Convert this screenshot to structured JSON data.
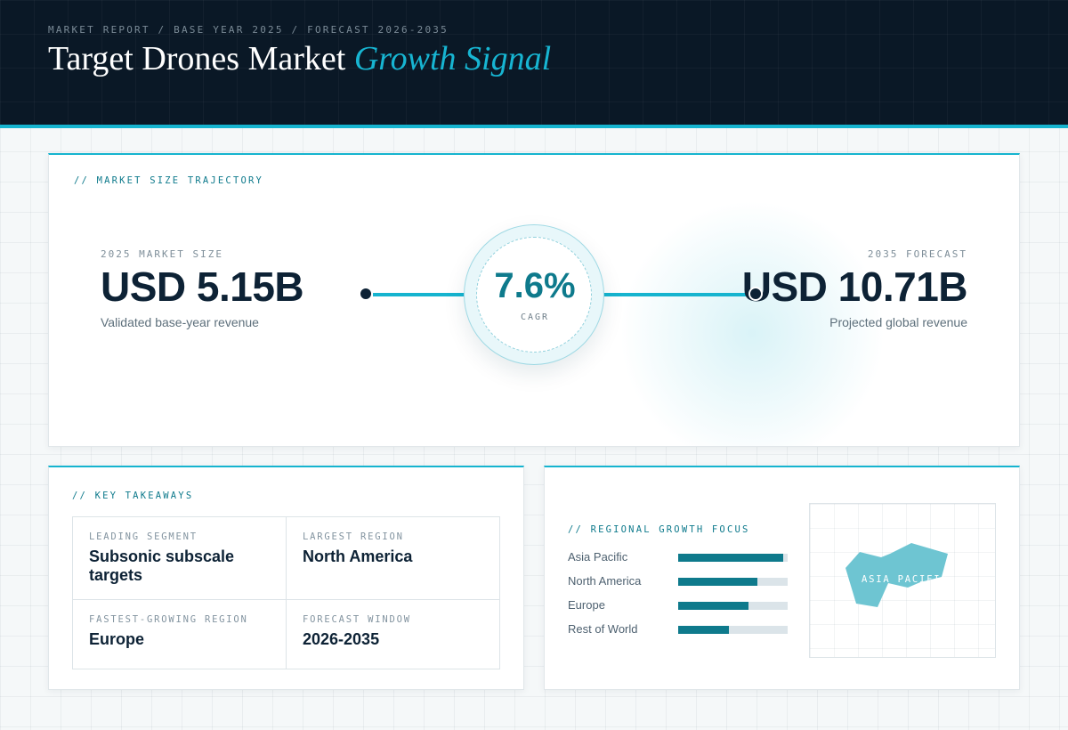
{
  "header": {
    "breadcrumb": "MARKET REPORT / BASE YEAR 2025 / FORECAST 2026-2035",
    "title_main": "Target Drones Market",
    "title_accent": "Growth Signal"
  },
  "trajectory": {
    "section_title": "// MARKET SIZE TRAJECTORY",
    "base": {
      "label": "2025 MARKET SIZE",
      "value": "USD 5.15B",
      "caption": "Validated base-year revenue"
    },
    "cagr": {
      "value": "7.6%",
      "label": "CAGR"
    },
    "forecast": {
      "label": "2035 FORECAST",
      "value": "USD 10.71B",
      "caption": "Projected global revenue"
    }
  },
  "takeaways": {
    "section_title": "// KEY TAKEAWAYS",
    "items": [
      {
        "label": "LEADING SEGMENT",
        "value": "Subsonic subscale targets"
      },
      {
        "label": "LARGEST REGION",
        "value": "North America"
      },
      {
        "label": "FASTEST-GROWING REGION",
        "value": "Europe"
      },
      {
        "label": "FORECAST WINDOW",
        "value": "2026-2035"
      }
    ]
  },
  "regional": {
    "section_title": "// REGIONAL GROWTH FOCUS",
    "bars": [
      {
        "label": "Asia Pacific",
        "level": 0.96
      },
      {
        "label": "North America",
        "level": 0.72
      },
      {
        "label": "Europe",
        "level": 0.64
      },
      {
        "label": "Rest of World",
        "level": 0.46
      }
    ],
    "map_label": "ASIA PACIFIC"
  },
  "colors": {
    "accent": "#16b4cf",
    "accent_dark": "#0e7a8c",
    "navy": "#0d2235",
    "map_fill": "#6ec5d2"
  }
}
